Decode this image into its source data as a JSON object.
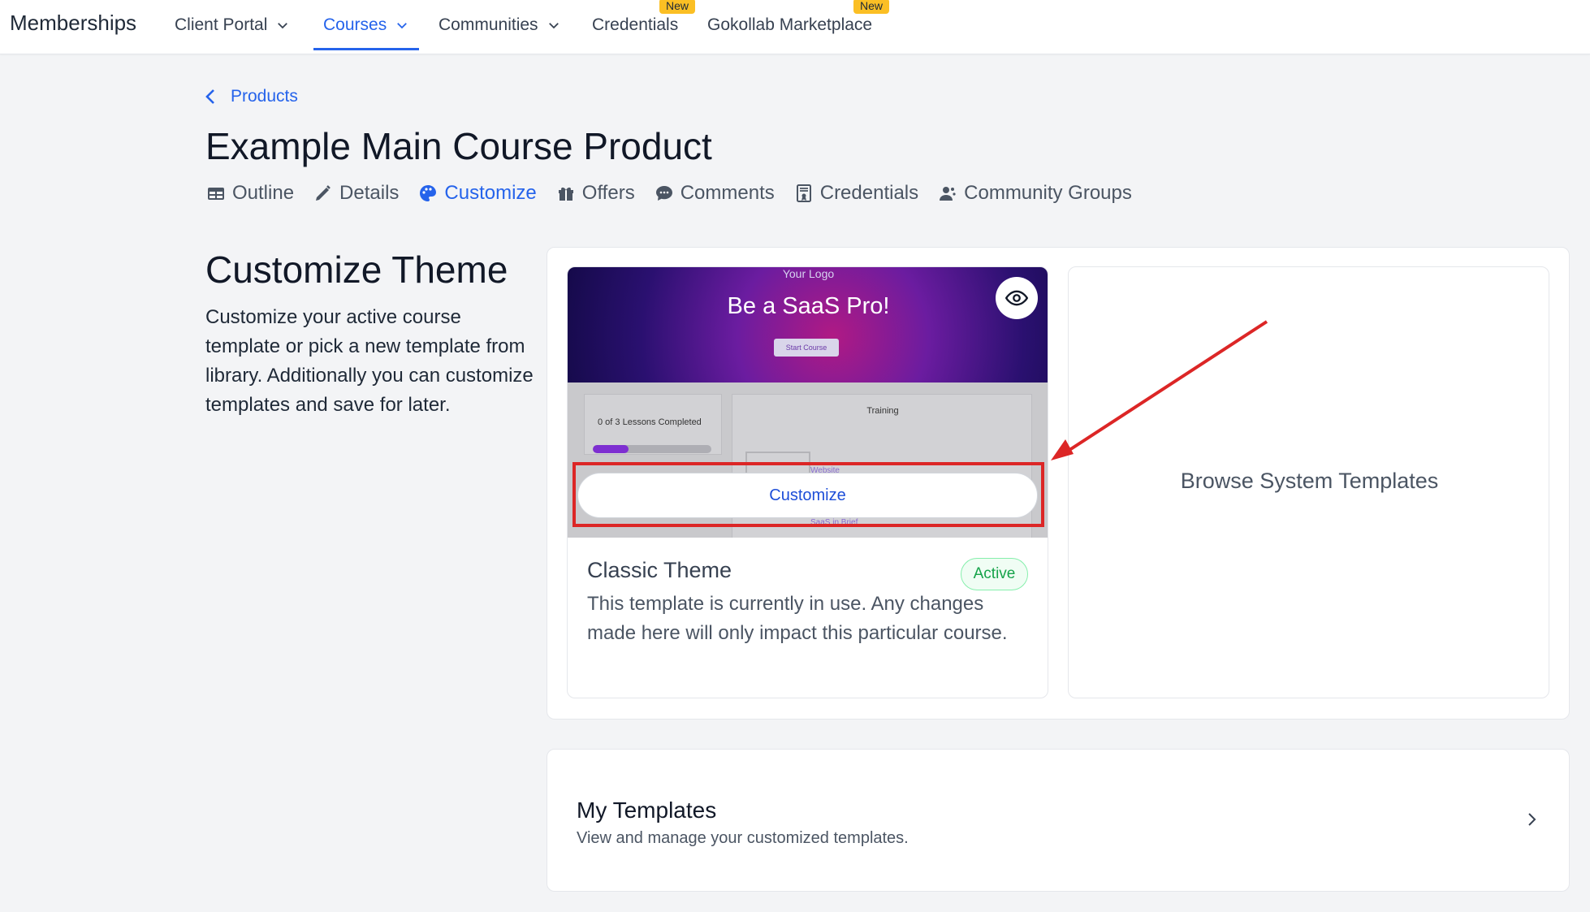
{
  "nav": {
    "brand": "Memberships",
    "items": [
      {
        "label": "Client Portal"
      },
      {
        "label": "Courses"
      },
      {
        "label": "Communities"
      },
      {
        "label": "Credentials",
        "badge": "New"
      },
      {
        "label": "Gokollab Marketplace",
        "badge": "New"
      }
    ]
  },
  "breadcrumb": {
    "label": "Products"
  },
  "page": {
    "title": "Example Main Course Product"
  },
  "tabs": [
    {
      "label": "Outline",
      "icon": "table-icon"
    },
    {
      "label": "Details",
      "icon": "pencil-icon"
    },
    {
      "label": "Customize",
      "icon": "palette-icon"
    },
    {
      "label": "Offers",
      "icon": "gift-icon"
    },
    {
      "label": "Comments",
      "icon": "comment-icon"
    },
    {
      "label": "Credentials",
      "icon": "certificate-icon"
    },
    {
      "label": "Community Groups",
      "icon": "user-group-icon"
    }
  ],
  "section": {
    "title": "Customize Theme",
    "description": "Customize your active course template or pick a new template from library. Additionally you can customize templates and save for later."
  },
  "theme_card": {
    "preview": {
      "logo_text": "Your Logo",
      "hero_title": "Be a SaaS Pro!",
      "start_button": "Start Course",
      "progress_label": "0 of 3 Lessons Completed",
      "progress_fraction": 0.3,
      "training_label": "Training",
      "ghost_label_1": "Website",
      "ghost_label_2": "SaaS in Brief"
    },
    "customize_label": "Customize",
    "title": "Classic Theme",
    "status": "Active",
    "description": "This template is currently in use. Any changes made here will only impact this particular course."
  },
  "browse": {
    "label": "Browse System Templates"
  },
  "my_templates": {
    "title": "My Templates",
    "description": "View and manage your customized templates."
  },
  "colors": {
    "accent": "#2563eb",
    "active_green": "#16a34a",
    "annotation_red": "#dc2626",
    "badge_yellow": "#fbbf24"
  }
}
